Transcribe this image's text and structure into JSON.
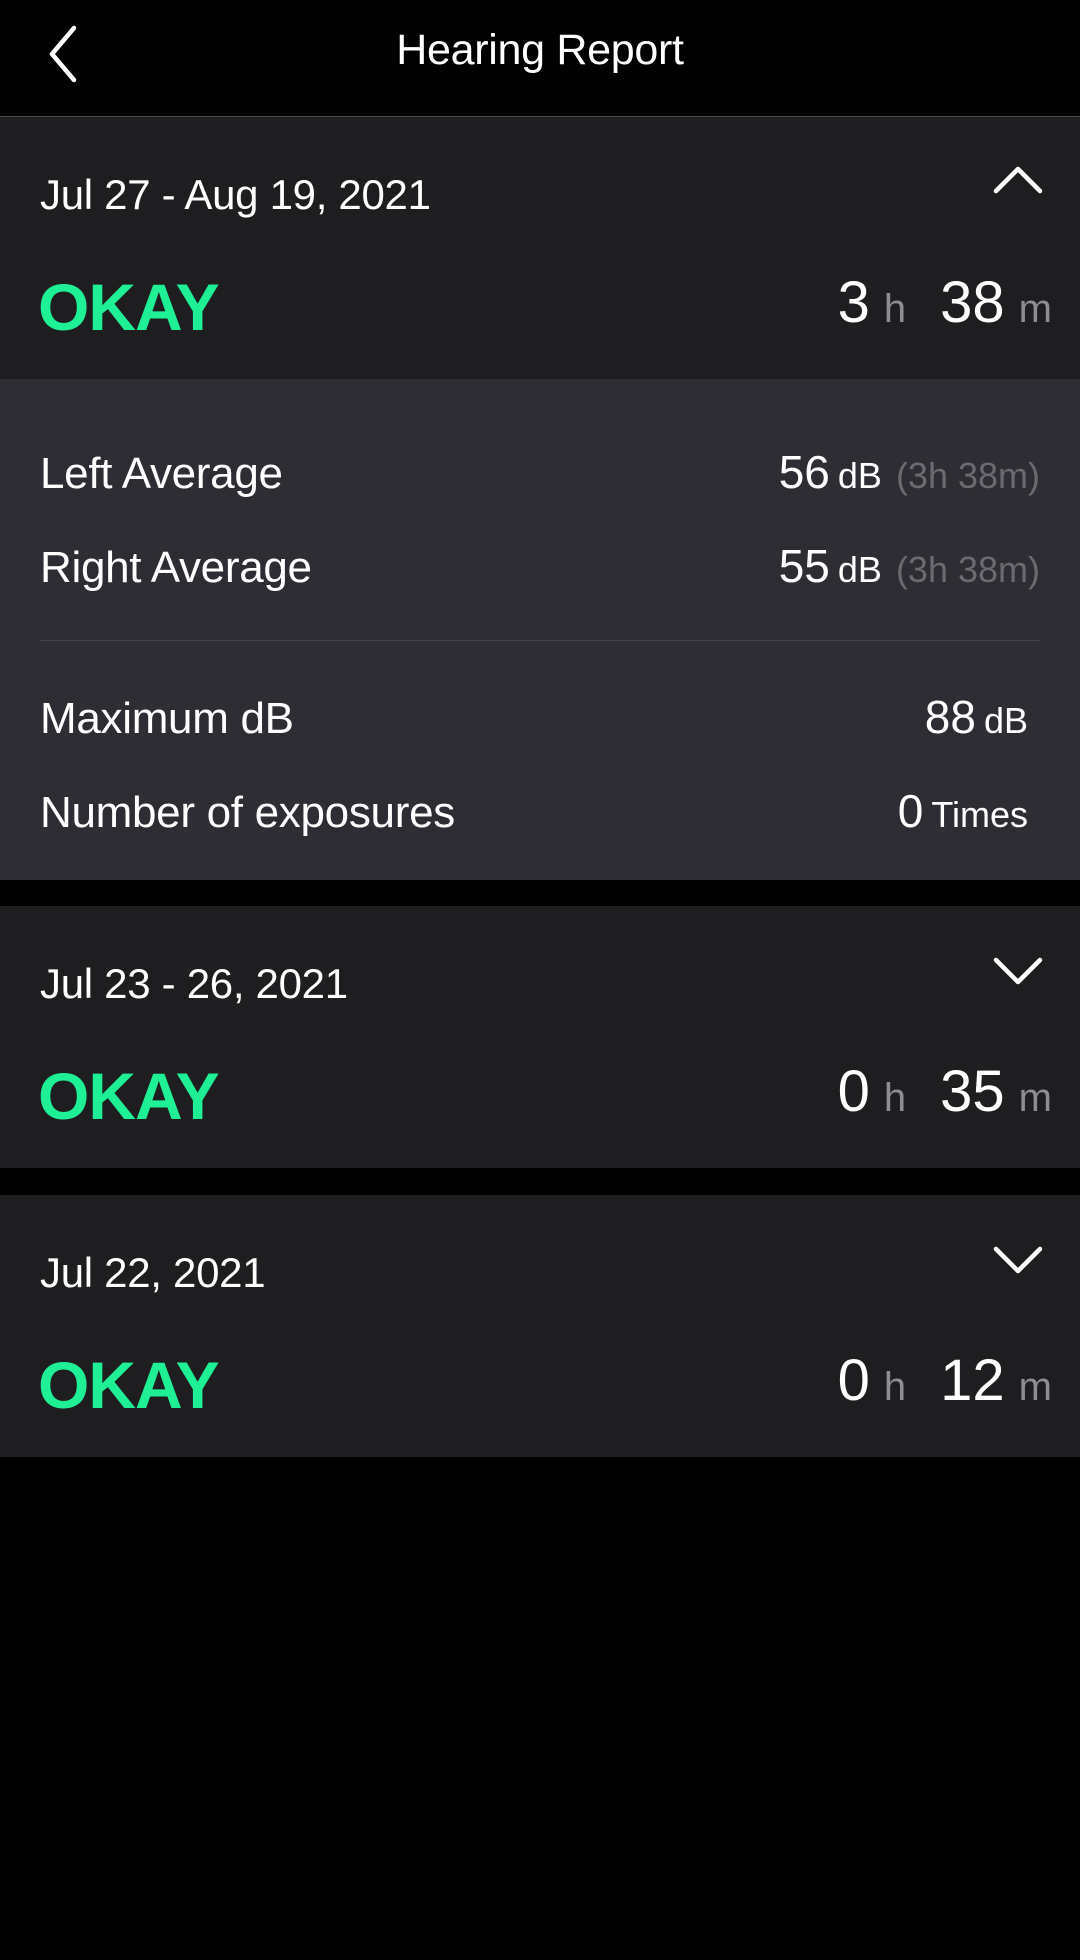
{
  "header": {
    "title": "Hearing Report",
    "back_icon": "chevron-left-icon"
  },
  "colors": {
    "status_ok": "#1ff095",
    "card_bg": "#1e1e20",
    "details_bg": "#2e2d33",
    "unit_muted": "#8e8e92"
  },
  "reports": [
    {
      "date_range": "Jul 27 - Aug 19, 2021",
      "expanded": true,
      "toggle_icon": "chevron-up-icon",
      "status": "OKAY",
      "duration": {
        "hours": "3",
        "hours_unit": "h",
        "minutes": "38",
        "minutes_unit": "m"
      },
      "details": {
        "left_average": {
          "label": "Left Average",
          "value": "56",
          "unit": "dB",
          "duration": "(3h 38m)"
        },
        "right_average": {
          "label": "Right Average",
          "value": "55",
          "unit": "dB",
          "duration": "(3h 38m)"
        },
        "maximum_db": {
          "label": "Maximum dB",
          "value": "88",
          "unit": "dB"
        },
        "exposures": {
          "label": "Number of exposures",
          "value": "0",
          "unit": "Times"
        }
      }
    },
    {
      "date_range": "Jul 23 - 26, 2021",
      "expanded": false,
      "toggle_icon": "chevron-down-icon",
      "status": "OKAY",
      "duration": {
        "hours": "0",
        "hours_unit": "h",
        "minutes": "35",
        "minutes_unit": "m"
      }
    },
    {
      "date_range": "Jul 22, 2021",
      "expanded": false,
      "toggle_icon": "chevron-down-icon",
      "status": "OKAY",
      "duration": {
        "hours": "0",
        "hours_unit": "h",
        "minutes": "12",
        "minutes_unit": "m"
      }
    }
  ]
}
